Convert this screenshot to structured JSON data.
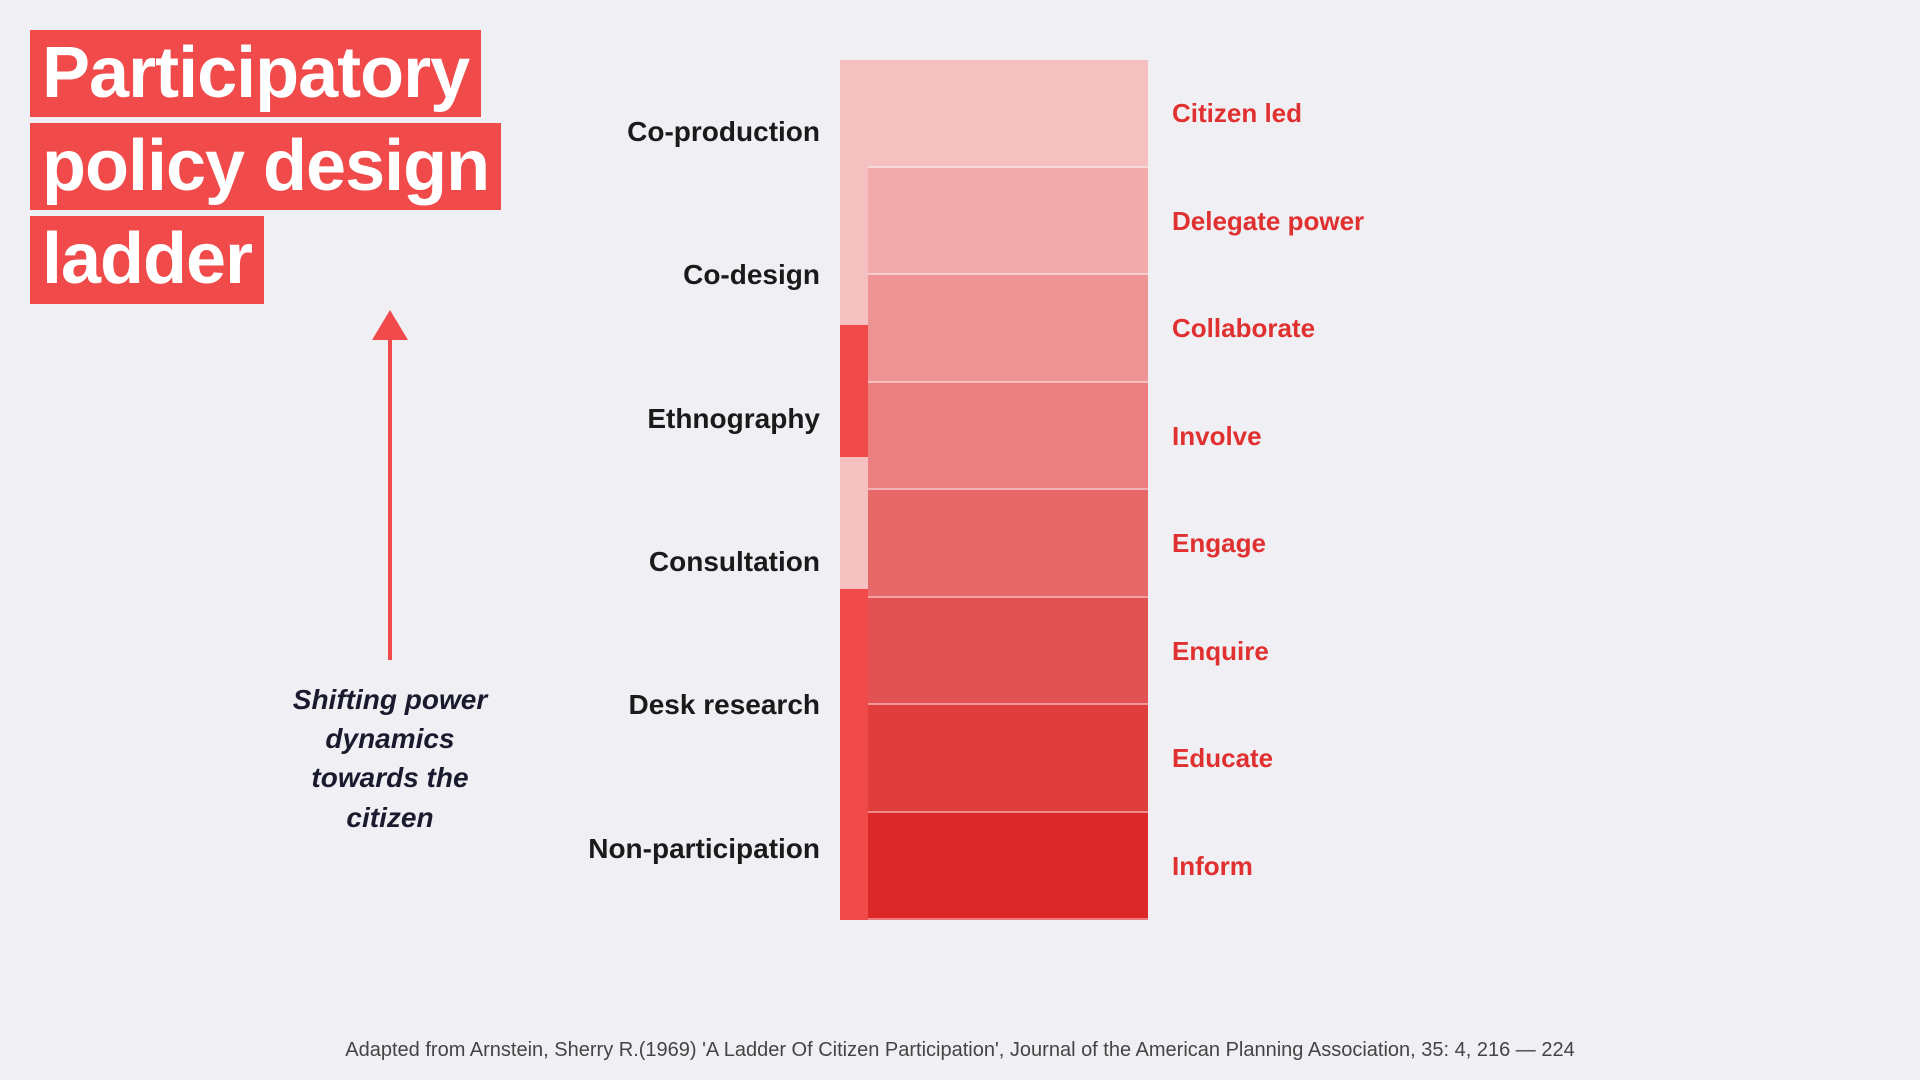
{
  "title": {
    "line1": "Participatory",
    "line2": "policy design",
    "line3": "ladder"
  },
  "arrow": {
    "label": "Shifting power dynamics towards the citizen"
  },
  "left_labels": [
    "Co-production",
    "Co-design",
    "Ethnography",
    "Consultation",
    "Desk research",
    "Non-participation"
  ],
  "right_labels": [
    "Citizen led",
    "Delegate power",
    "Collaborate",
    "Involve",
    "Engage",
    "Enquire",
    "Educate",
    "Inform"
  ],
  "bar_colors": {
    "seg0": "#f5c0c0",
    "seg1": "#f2aaaa",
    "seg2": "#ef9494",
    "seg3": "#eb7e7e",
    "seg4": "#e76868",
    "seg5": "#e35252",
    "seg6": "#e03d3d",
    "seg7": "#dc2828"
  },
  "indicator_colors": {
    "top": "#f5c0c0",
    "mid_upper": "#ef9494",
    "mid_lower": "#f04a4a",
    "bot": "#dc2828"
  },
  "footer": "Adapted from Arnstein, Sherry R.(1969) 'A Ladder Of Citizen Participation', Journal of the American Planning Association, 35: 4, 216 — 224"
}
